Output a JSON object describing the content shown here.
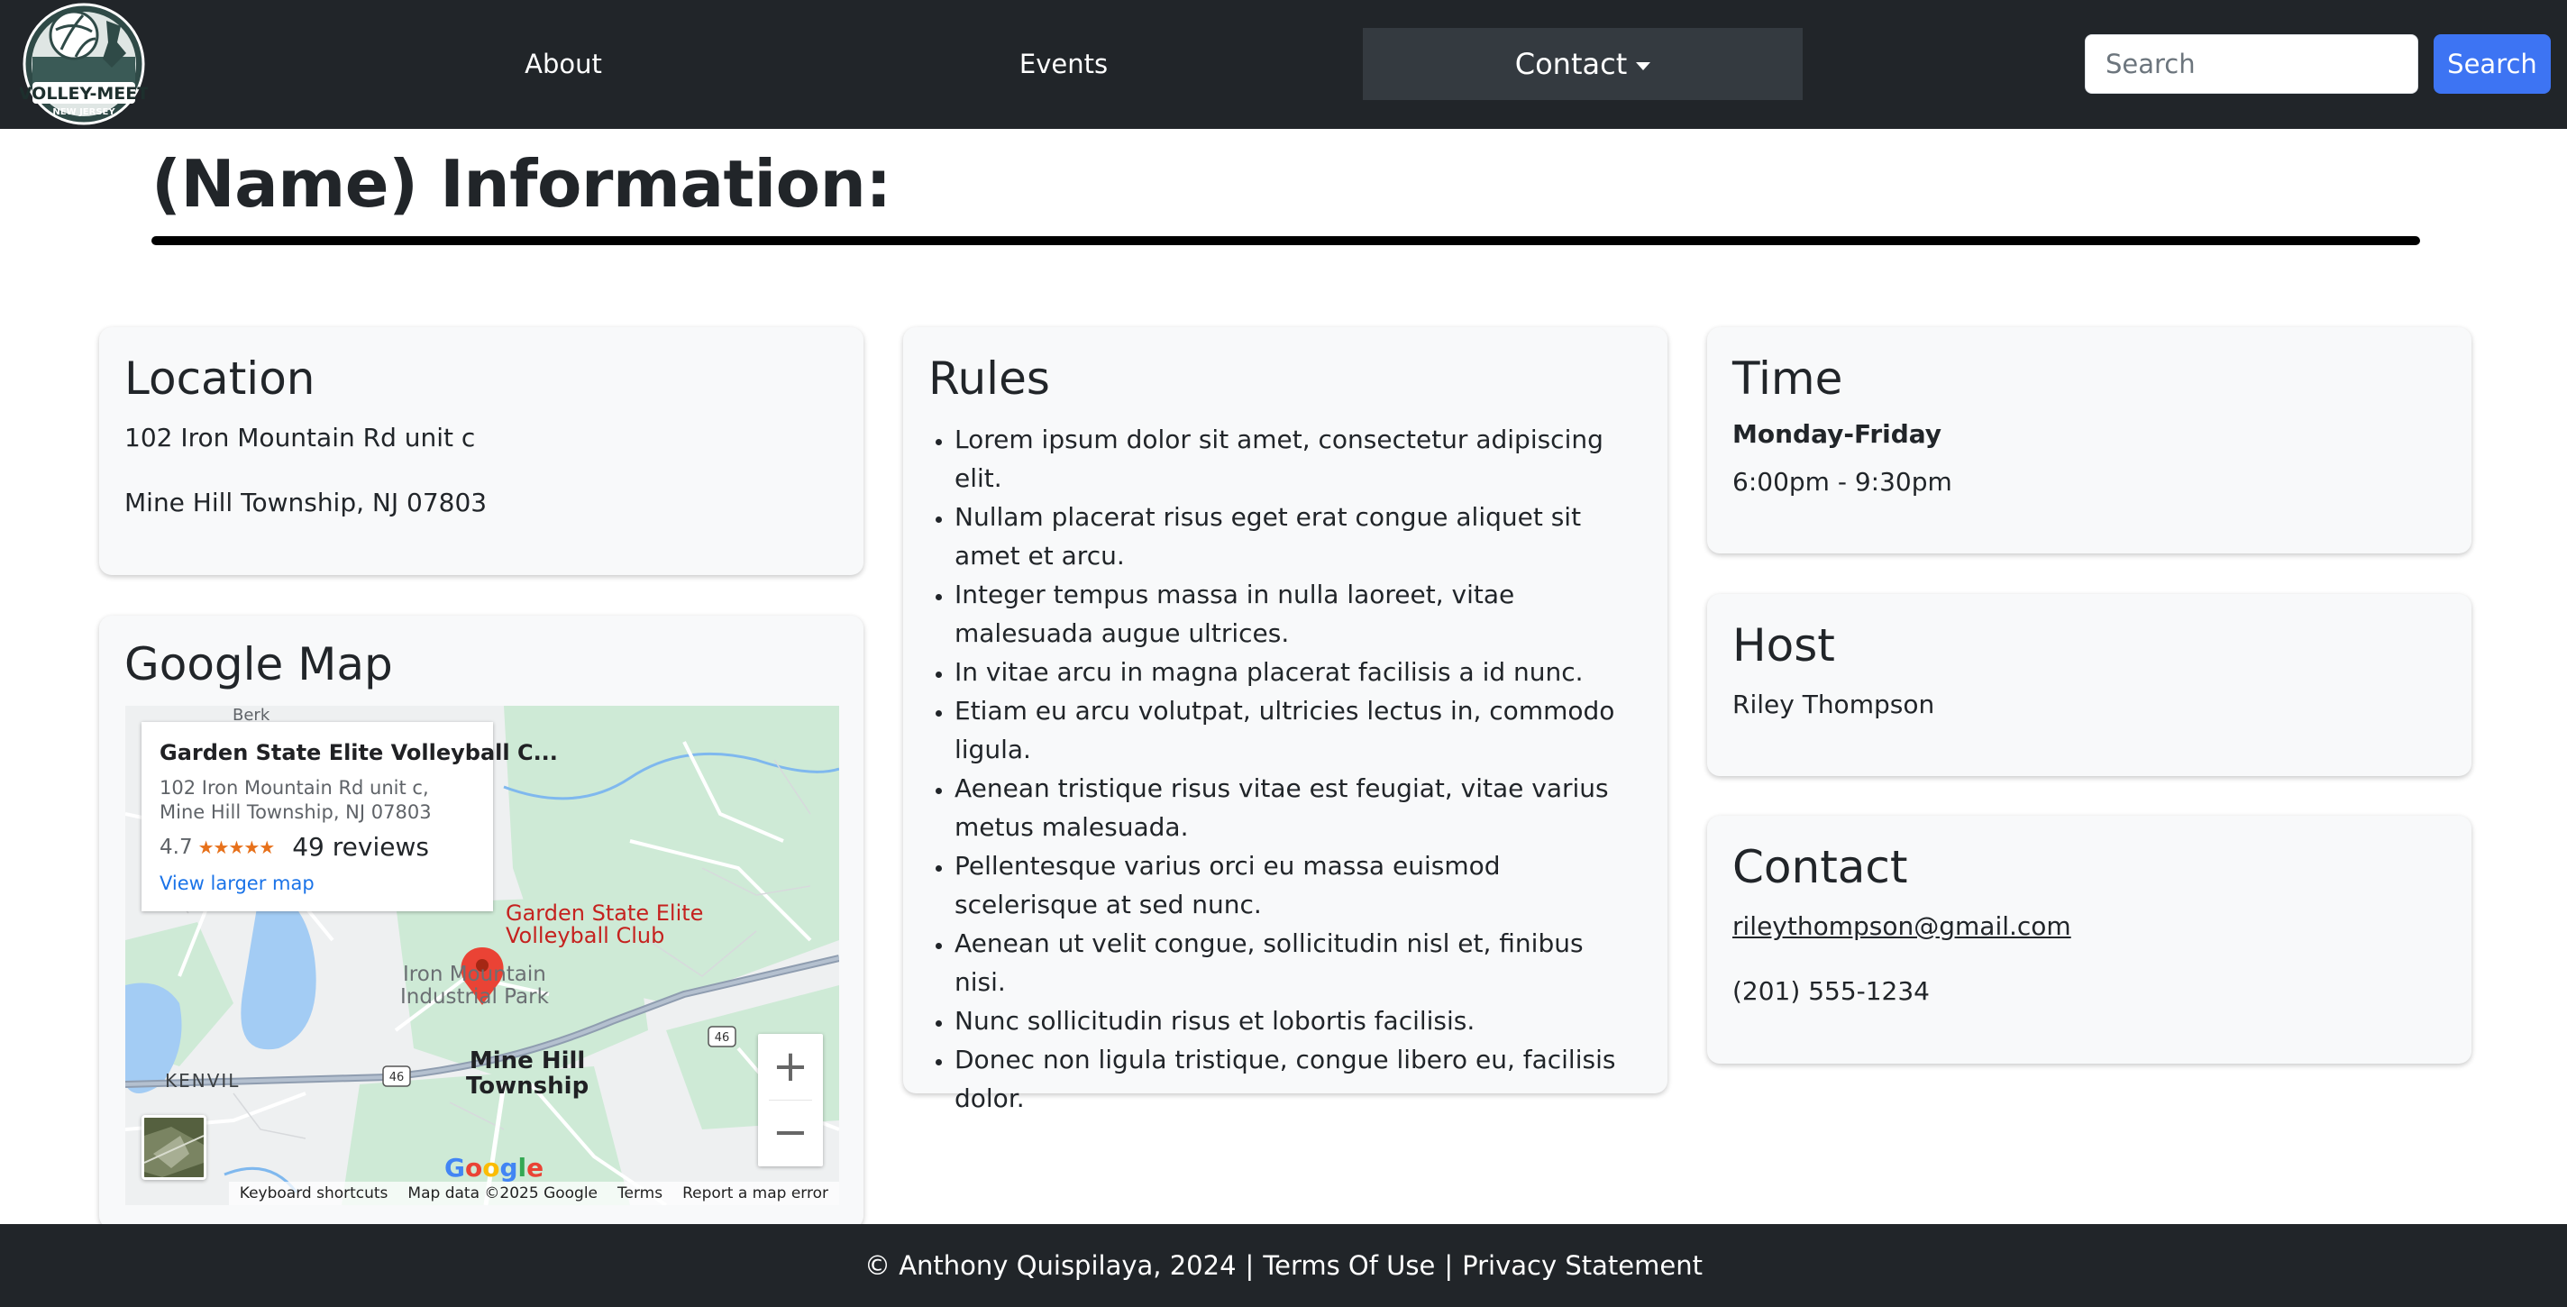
{
  "navbar": {
    "logo_text": "VOLLEY-MEET",
    "logo_subtext": "NEW JERSEY",
    "links": [
      {
        "label": "About"
      },
      {
        "label": "Events"
      }
    ],
    "contact_dropdown": "Contact",
    "search": {
      "placeholder": "Search",
      "button_label": "Search"
    },
    "colors": {
      "background": "#212529",
      "accent": "#3d74f3",
      "active": "#343a40"
    }
  },
  "page": {
    "title": "(Name) Information:"
  },
  "location": {
    "heading": "Location",
    "address_line1": "102 Iron Mountain Rd unit c",
    "address_line2": "Mine Hill Township, NJ 07803"
  },
  "map_card": {
    "heading": "Google Map",
    "info": {
      "name": "Garden State Elite Volleyball C...",
      "address": "102 Iron Mountain Rd unit c, Mine Hill Township, NJ 07803",
      "rating": "4.7",
      "stars": "★★★★★",
      "reviews": "49 reviews",
      "larger_map": "View larger map"
    },
    "labels": {
      "place": "Garden State Elite Volleyball Club",
      "place_line1": "Garden State Elite",
      "place_line2": "Volleyball Club",
      "park_line1": "Iron Mountain",
      "park_line2": "Industrial Park",
      "town_line1": "Mine Hill",
      "town_line2": "Township",
      "kenvil": "KENVIL",
      "route": "46",
      "berk": "Berk"
    },
    "zoom_in": "+",
    "zoom_out": "−",
    "google_logo": "Google",
    "attribution": {
      "shortcuts": "Keyboard shortcuts",
      "data": "Map data ©2025 Google",
      "terms": "Terms",
      "report": "Report a map error"
    }
  },
  "rules": {
    "heading": "Rules",
    "items": [
      "Lorem ipsum dolor sit amet, consectetur adipiscing elit.",
      "Nullam placerat risus eget erat congue aliquet sit amet et arcu.",
      "Integer tempus massa in nulla laoreet, vitae malesuada augue ultrices.",
      "In vitae arcu in magna placerat facilisis a id nunc.",
      "Etiam eu arcu volutpat, ultricies lectus in, commodo ligula.",
      "Aenean tristique risus vitae est feugiat, vitae varius metus malesuada.",
      "Pellentesque varius orci eu massa euismod scelerisque at sed nunc.",
      "Aenean ut velit congue, sollicitudin nisl et, finibus nisi.",
      "Nunc sollicitudin risus et lobortis facilisis.",
      "Donec non ligula tristique, congue libero eu, facilisis dolor."
    ]
  },
  "time": {
    "heading": "Time",
    "days": "Monday-Friday",
    "hours": "6:00pm - 9:30pm"
  },
  "host": {
    "heading": "Host",
    "name": "Riley Thompson"
  },
  "contact": {
    "heading": "Contact",
    "email": "rileythompson@gmail.com",
    "phone": "(201) 555-1234"
  },
  "footer": {
    "copyright": "© Anthony Quispilaya, 2024",
    "separator": "|",
    "terms": "Terms Of Use",
    "privacy": "Privacy Statement"
  }
}
